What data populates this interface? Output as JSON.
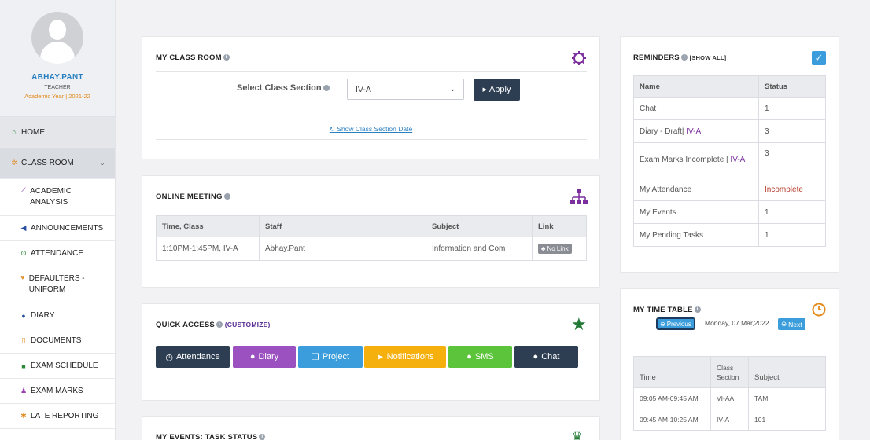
{
  "profile": {
    "name": "ABHAY.PANT",
    "role": "TEACHER",
    "year": "Academic Year | 2021-22"
  },
  "nav": {
    "home": "HOME",
    "classroom": "CLASS ROOM",
    "items": [
      "ACADEMIC ANALYSIS",
      "ANNOUNCEMENTS",
      "ATTENDANCE",
      "DEFAULTERS - UNIFORM",
      "DIARY",
      "DOCUMENTS",
      "EXAM SCHEDULE",
      "EXAM MARKS",
      "LATE REPORTING"
    ]
  },
  "classroom": {
    "title": "MY CLASS ROOM",
    "select_label": "Select Class Section",
    "selected": "IV-A",
    "apply": "Apply",
    "show_dates": "Show Class Section Date"
  },
  "meeting": {
    "title": "ONLINE MEETING",
    "headers": [
      "Time, Class",
      "Staff",
      "Subject",
      "Link"
    ],
    "row": {
      "time": "1:10PM-1:45PM, IV-A",
      "staff": "Abhay.Pant",
      "subject": "Information and Com",
      "link": "No Link"
    }
  },
  "quick": {
    "title": "QUICK ACCESS",
    "customize": "(CUSTOMIZE)",
    "buttons": [
      "Attendance",
      "Diary",
      "Project",
      "Notifications",
      "SMS",
      "Chat"
    ]
  },
  "events": {
    "title": "MY EVENTS: TASK STATUS"
  },
  "reminders": {
    "title": "REMINDERS",
    "show_all": "[SHOW ALL]",
    "headers": [
      "Name",
      "Status"
    ],
    "rows": [
      {
        "name": "Chat",
        "status": "1"
      },
      {
        "name": "Diary - Draft|",
        "tag": "IV-A",
        "status": "3"
      },
      {
        "name": "Exam Marks Incomplete |",
        "tag": "IV-A",
        "status": "3"
      },
      {
        "name": "My Attendance",
        "status": "Incomplete"
      },
      {
        "name": "My Events",
        "status": "1"
      },
      {
        "name": "My Pending Tasks",
        "status": "1"
      }
    ]
  },
  "timetable": {
    "title": "MY TIME TABLE",
    "previous": "Previous",
    "date": "Monday, 07 Mar,2022",
    "next": "Next",
    "headers": [
      "Time",
      "Class Section",
      "Subject"
    ],
    "rows": [
      {
        "time": "09:05 AM-09:45 AM",
        "class": "VI-AA",
        "subject": "TAM"
      },
      {
        "time": "09:45 AM-10:25 AM",
        "class": "IV-A",
        "subject": "101"
      }
    ]
  },
  "colors": {
    "attendance": "#2e3e52",
    "diary": "#9b52c0",
    "project": "#3b9ddb",
    "notifications": "#f5b00e",
    "sms": "#5bc43a",
    "chat": "#2e3e52"
  }
}
